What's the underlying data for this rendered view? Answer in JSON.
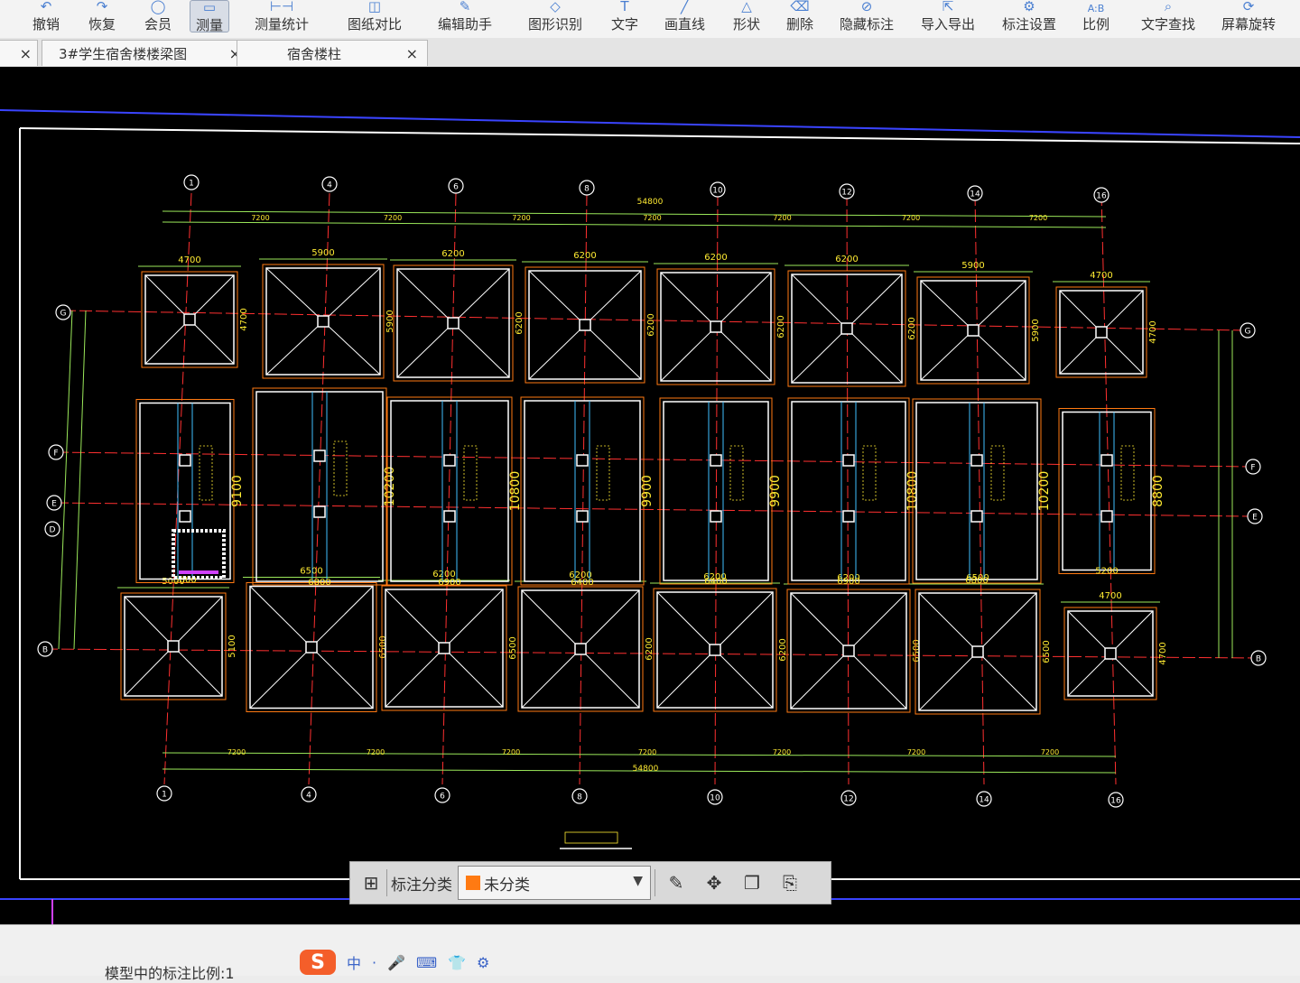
{
  "toolbar": {
    "items": [
      {
        "label": "撤销",
        "icon": "undo-icon"
      },
      {
        "label": "恢复",
        "icon": "redo-icon"
      },
      {
        "label": "会员",
        "icon": "member-icon"
      },
      {
        "label": "测量",
        "icon": "measure-icon"
      },
      {
        "label": "测量统计",
        "icon": "measure-stats-icon"
      },
      {
        "label": "图纸对比",
        "icon": "compare-icon"
      },
      {
        "label": "编辑助手",
        "icon": "edit-assistant-icon"
      },
      {
        "label": "图形识别",
        "icon": "shape-recognition-icon"
      },
      {
        "label": "文字",
        "icon": "text-icon"
      },
      {
        "label": "画直线",
        "icon": "line-icon"
      },
      {
        "label": "形状",
        "icon": "shape-icon"
      },
      {
        "label": "删除",
        "icon": "eraser-icon"
      },
      {
        "label": "隐藏标注",
        "icon": "hide-eye-icon"
      },
      {
        "label": "导入导出",
        "icon": "import-export-icon"
      },
      {
        "label": "标注设置",
        "icon": "settings-icon"
      },
      {
        "label": "比例",
        "icon": "scale-icon"
      },
      {
        "label": "文字查找",
        "icon": "text-search-icon"
      },
      {
        "label": "屏幕旋转",
        "icon": "rotate-screen-icon"
      }
    ],
    "scale_icon_text": "A:B"
  },
  "tabs": [
    {
      "label": "3#学生宿舍楼楼梁图",
      "close": "×"
    },
    {
      "label": "宿舍楼柱",
      "close": "×"
    }
  ],
  "drawing": {
    "axes_top": [
      "1",
      "4",
      "6",
      "8",
      "10",
      "12",
      "14",
      "16"
    ],
    "axes_bottom": [
      "1",
      "4",
      "6",
      "8",
      "10",
      "12",
      "14",
      "16"
    ],
    "axes_left": [
      "G",
      "F",
      "E",
      "D",
      "B"
    ],
    "axes_right": [
      "G",
      "F",
      "E",
      "B"
    ],
    "top_row_dims": [
      "4700",
      "5900",
      "6200",
      "6200",
      "6200",
      "6200",
      "5900",
      "4700"
    ],
    "top_row_side": [
      "4700",
      "5900",
      "6200",
      "6200",
      "6200",
      "6200",
      "5900",
      "4700"
    ],
    "mid_row_dims": [
      "9100",
      "10200",
      "10800",
      "9900",
      "9900",
      "10800",
      "10200",
      "8800"
    ],
    "mid_row_bottom": [
      "5000",
      "6800",
      "6900",
      "6400",
      "6400",
      "6900",
      "6800",
      "5200"
    ],
    "bottom_row_dims": [
      "5000",
      "6500",
      "6200",
      "6200",
      "6200",
      "6200",
      "6500",
      "4700"
    ],
    "bottom_row_side": [
      "5100",
      "6500",
      "6500",
      "6200",
      "6200",
      "6500",
      "6500",
      "4700"
    ],
    "bay_dims": [
      "7200",
      "7200",
      "7200",
      "7200",
      "7200",
      "7200",
      "7200"
    ],
    "total_dim": "54800"
  },
  "float_bar": {
    "label": "标注分类",
    "category": "未分类",
    "category_color": "#ff7a12"
  },
  "status": {
    "scale_label": "模型中的标注比例:1"
  },
  "ime": {
    "logo": "S",
    "items": [
      "中",
      "·",
      "🎤",
      "⌨",
      "👕",
      "⚙"
    ]
  }
}
